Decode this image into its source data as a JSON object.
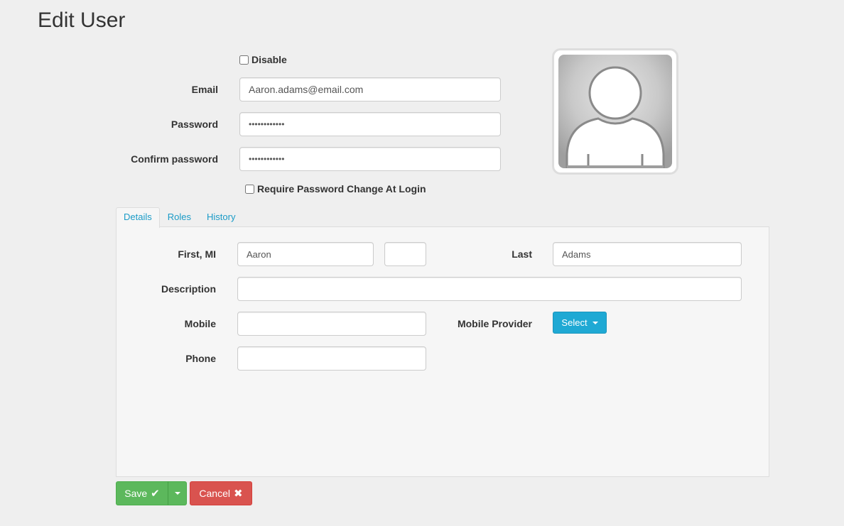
{
  "page": {
    "title": "Edit User"
  },
  "account": {
    "disable_label": "Disable",
    "disable_checked": false,
    "email_label": "Email",
    "email_value": "Aaron.adams@email.com",
    "password_label": "Password",
    "password_value": "••••••••••••",
    "confirm_label": "Confirm password",
    "confirm_value": "••••••••••••",
    "require_change_label": "Require Password Change At Login",
    "require_change_checked": false
  },
  "tabs": [
    {
      "label": "Details",
      "active": true
    },
    {
      "label": "Roles",
      "active": false
    },
    {
      "label": "History",
      "active": false
    }
  ],
  "details": {
    "first_mi_label": "First, MI",
    "first_value": "Aaron",
    "mi_value": "",
    "last_label": "Last",
    "last_value": "Adams",
    "description_label": "Description",
    "description_value": "",
    "mobile_label": "Mobile",
    "mobile_value": "",
    "mobile_provider_label": "Mobile Provider",
    "mobile_provider_select": "Select",
    "phone_label": "Phone",
    "phone_value": ""
  },
  "actions": {
    "save_label": "Save",
    "save_icon": "checkmark-icon",
    "cancel_label": "Cancel",
    "cancel_icon": "close-x-icon"
  },
  "avatar": {
    "icon": "default-user-avatar-icon"
  },
  "colors": {
    "accent": "#1fa9d4",
    "save": "#5cb85c",
    "cancel": "#d9534f",
    "tab_link": "#1a9bc7"
  }
}
